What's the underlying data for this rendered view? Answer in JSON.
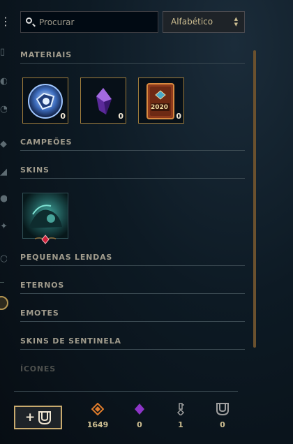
{
  "search": {
    "placeholder": "Procurar",
    "value": ""
  },
  "sort": {
    "label": "Alfabético"
  },
  "sections": {
    "materiais": "MATERIAIS",
    "campeoes": "CAMPEÕES",
    "skins": "SKINS",
    "pequenas_lendas": "PEQUENAS LENDAS",
    "eternos": "ETERNOS",
    "emotes": "EMOTES",
    "skins_sentinela": "SKINS DE SENTINELA",
    "icones": "ÍCONES"
  },
  "materials": [
    {
      "name": "token",
      "count": "0"
    },
    {
      "name": "gem",
      "count": "0"
    },
    {
      "name": "card-2020",
      "count": "0",
      "card_text": "2020"
    }
  ],
  "currency": [
    {
      "icon": "orange-essence-icon",
      "value": "1649"
    },
    {
      "icon": "mythic-essence-icon",
      "value": "0"
    },
    {
      "icon": "key-icon",
      "value": "1"
    },
    {
      "icon": "chest-icon",
      "value": "0"
    }
  ],
  "add_button": {
    "label": "+"
  },
  "colors": {
    "gold": "#c8aa6e",
    "text": "#a09b8c",
    "bg": "#0d1a24",
    "accent_purple": "#8d35c7",
    "accent_orange": "#e07c2c"
  }
}
